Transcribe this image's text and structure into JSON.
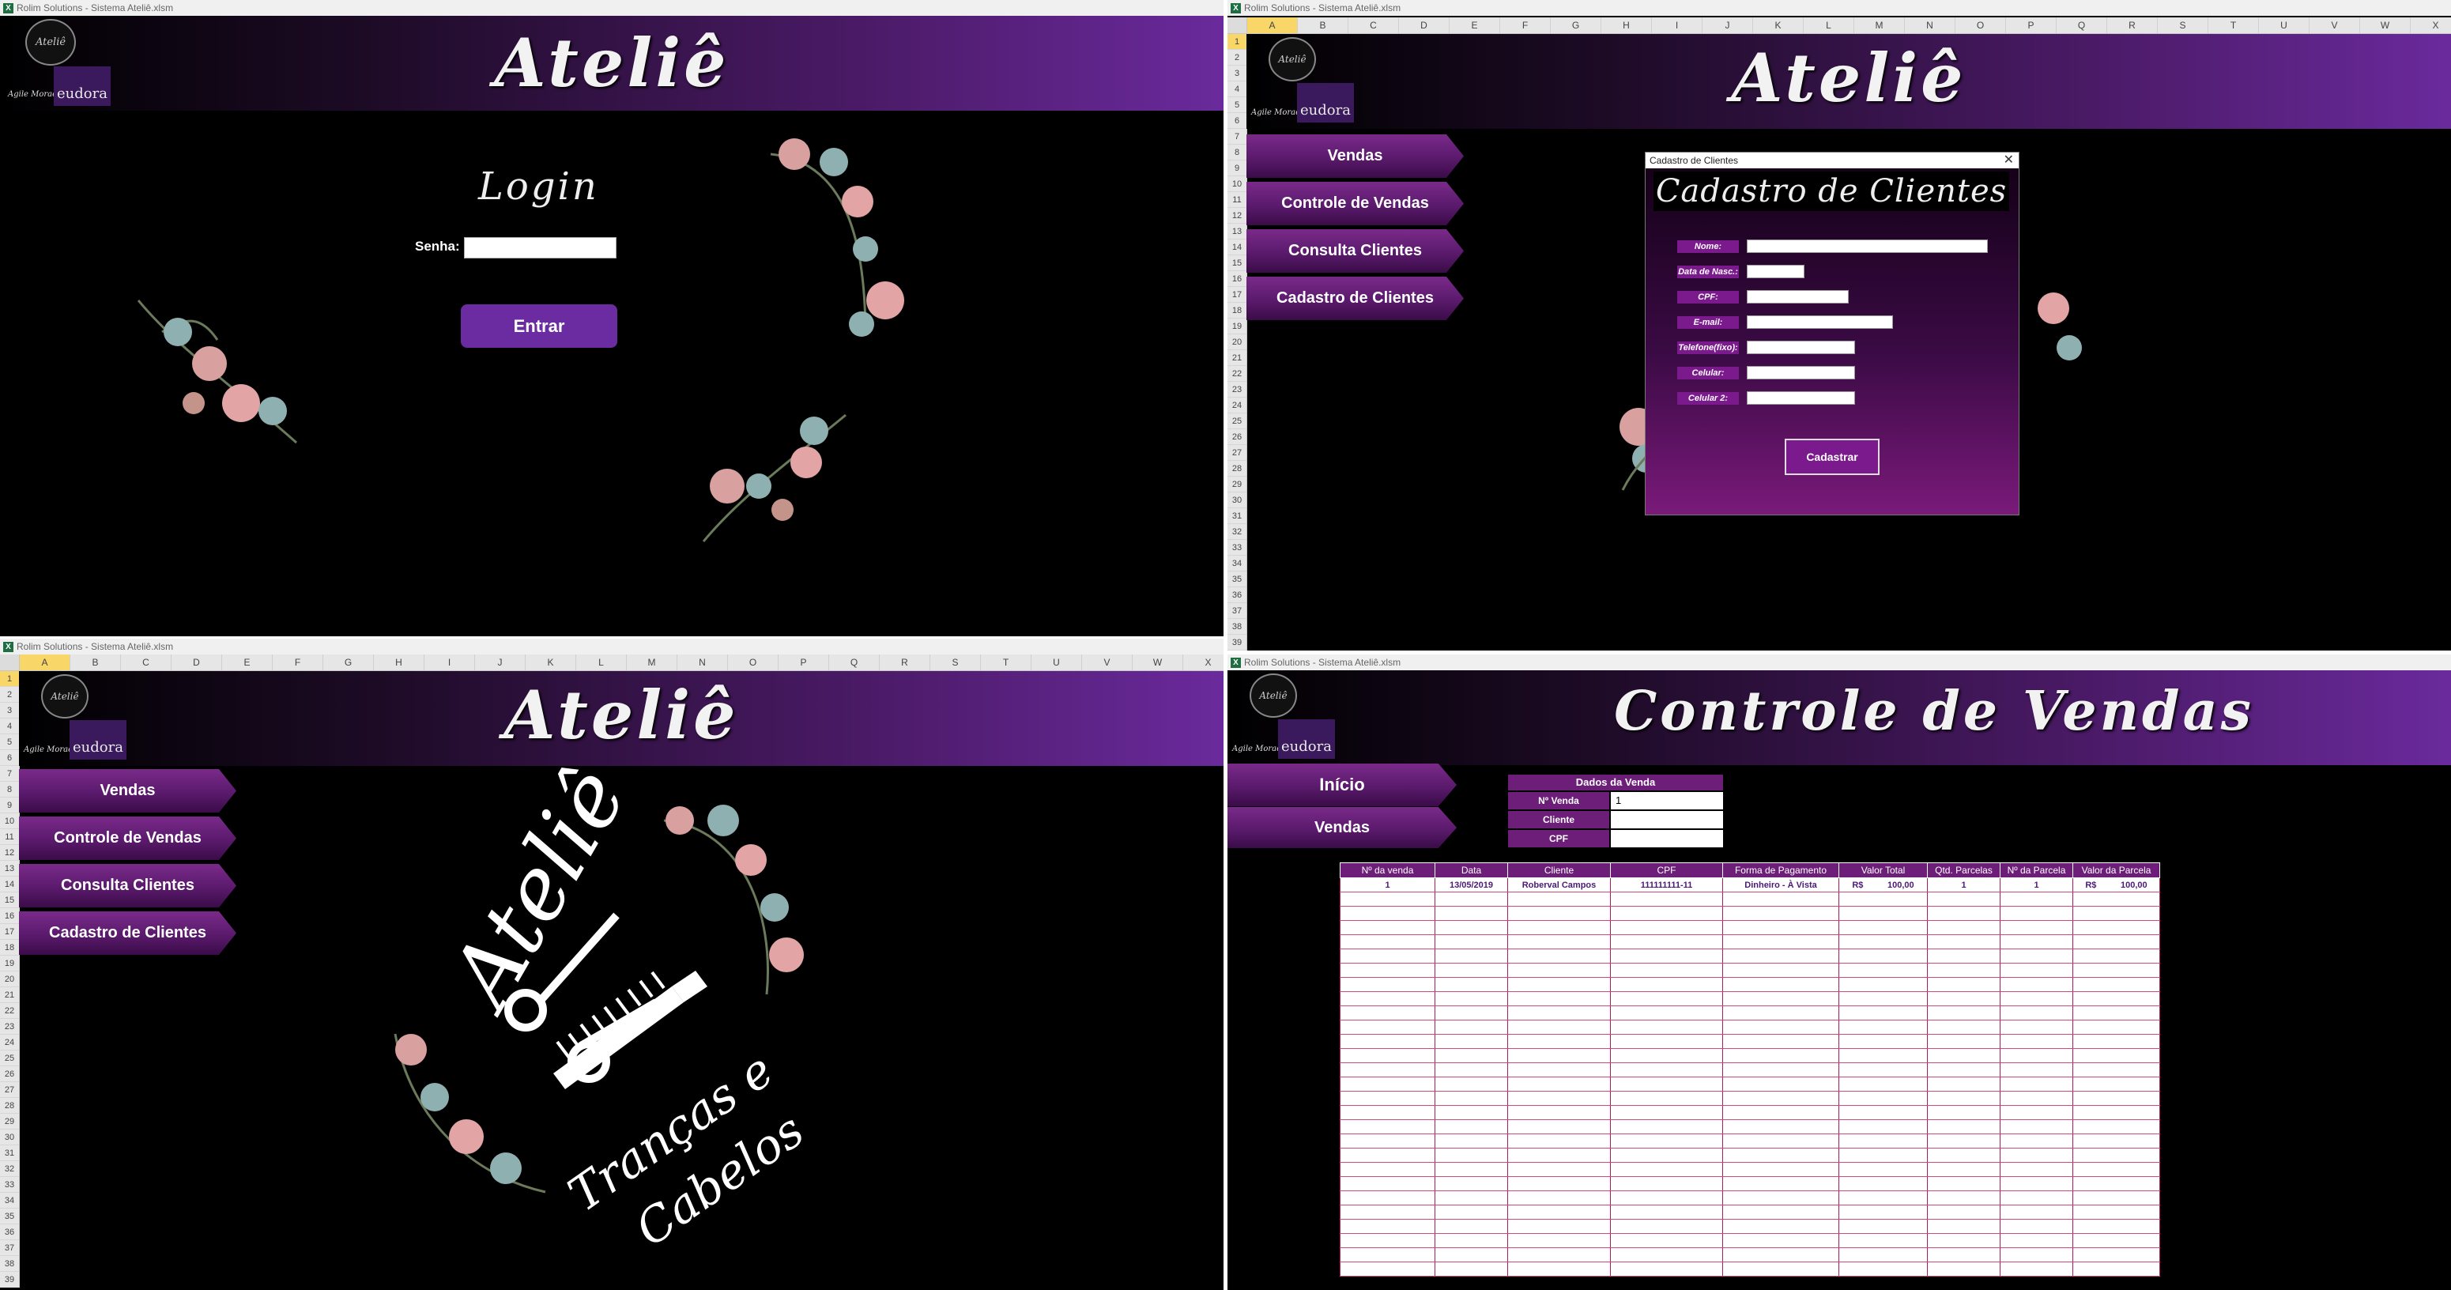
{
  "login_window": {
    "title": "Rolim Solutions - Sistema Ateliê.xlsm",
    "banner_title": "Ateliê",
    "logo_text": "Ateliê",
    "agile_text": "Agile Moraes",
    "eudora_text": "eudora",
    "login_title": "Login",
    "password_label": "Senha:",
    "password_value": "",
    "enter_button": "Entrar"
  },
  "cadastro_window": {
    "title": "Rolim Solutions - Sistema Ateliê.xlsm",
    "columns": [
      "A",
      "B",
      "C",
      "D",
      "E",
      "F",
      "G",
      "H",
      "I",
      "J",
      "K",
      "L",
      "M",
      "N",
      "O",
      "P",
      "Q",
      "R",
      "S",
      "T",
      "U",
      "V",
      "W",
      "X"
    ],
    "banner_title": "Ateliê",
    "nav": [
      "Vendas",
      "Controle de Vendas",
      "Consulta Clientes",
      "Cadastro de Clientes"
    ],
    "dialog": {
      "window_title": "Cadastro de Clientes",
      "heading": "Cadastro de Clientes",
      "fields": [
        "Nome:",
        "Data de Nasc.:",
        "CPF:",
        "E-mail:",
        "Telefone(fixo):",
        "Celular:",
        "Celular 2:"
      ],
      "submit_button": "Cadastrar"
    }
  },
  "home_window": {
    "title": "Rolim Solutions - Sistema Ateliê.xlsm",
    "columns": [
      "A",
      "B",
      "C",
      "D",
      "E",
      "F",
      "G",
      "H",
      "I",
      "J",
      "K",
      "L",
      "M",
      "N",
      "O",
      "P",
      "Q",
      "R",
      "S",
      "T",
      "U",
      "V",
      "W",
      "X"
    ],
    "banner_title": "Ateliê",
    "nav": [
      "Vendas",
      "Controle de Vendas",
      "Consulta Clientes",
      "Cadastro de Clientes"
    ],
    "logo_top": "Ateliê",
    "logo_bottom_1": "Tranças e",
    "logo_bottom_2": "Cabelos"
  },
  "controle_window": {
    "title": "Rolim Solutions - Sistema Ateliê.xlsm",
    "banner_title": "Controle de Vendas",
    "nav": [
      "Início",
      "Vendas"
    ],
    "dados_venda": {
      "header": "Dados da Venda",
      "labels": [
        "Nº Venda",
        "Cliente",
        "CPF"
      ],
      "values": [
        "1",
        "",
        ""
      ]
    },
    "table": {
      "headers": [
        "Nº da venda",
        "Data",
        "Cliente",
        "CPF",
        "Forma de Pagamento",
        "Valor Total",
        "Qtd. Parcelas",
        "Nº da Parcela",
        "Valor da Parcela"
      ],
      "rows": [
        [
          "1",
          "13/05/2019",
          "Roberval Campos",
          "111111111-11",
          "Dinheiro - À Vista",
          "R$          100,00",
          "1",
          "1",
          "R$          100,00"
        ]
      ]
    }
  },
  "row_numbers": [
    "1",
    "2",
    "3",
    "4",
    "5",
    "6",
    "7",
    "8",
    "9",
    "10",
    "11",
    "12",
    "13",
    "14",
    "15",
    "16",
    "17",
    "18",
    "19",
    "20",
    "21",
    "22",
    "23",
    "24",
    "25",
    "26",
    "27",
    "28",
    "29",
    "30",
    "31",
    "32",
    "33",
    "34",
    "35",
    "36",
    "37",
    "38",
    "39"
  ],
  "colors": {
    "accent": "#6c1e78",
    "brand_purple": "#6a2ca0",
    "selected_header": "#f8d668"
  }
}
